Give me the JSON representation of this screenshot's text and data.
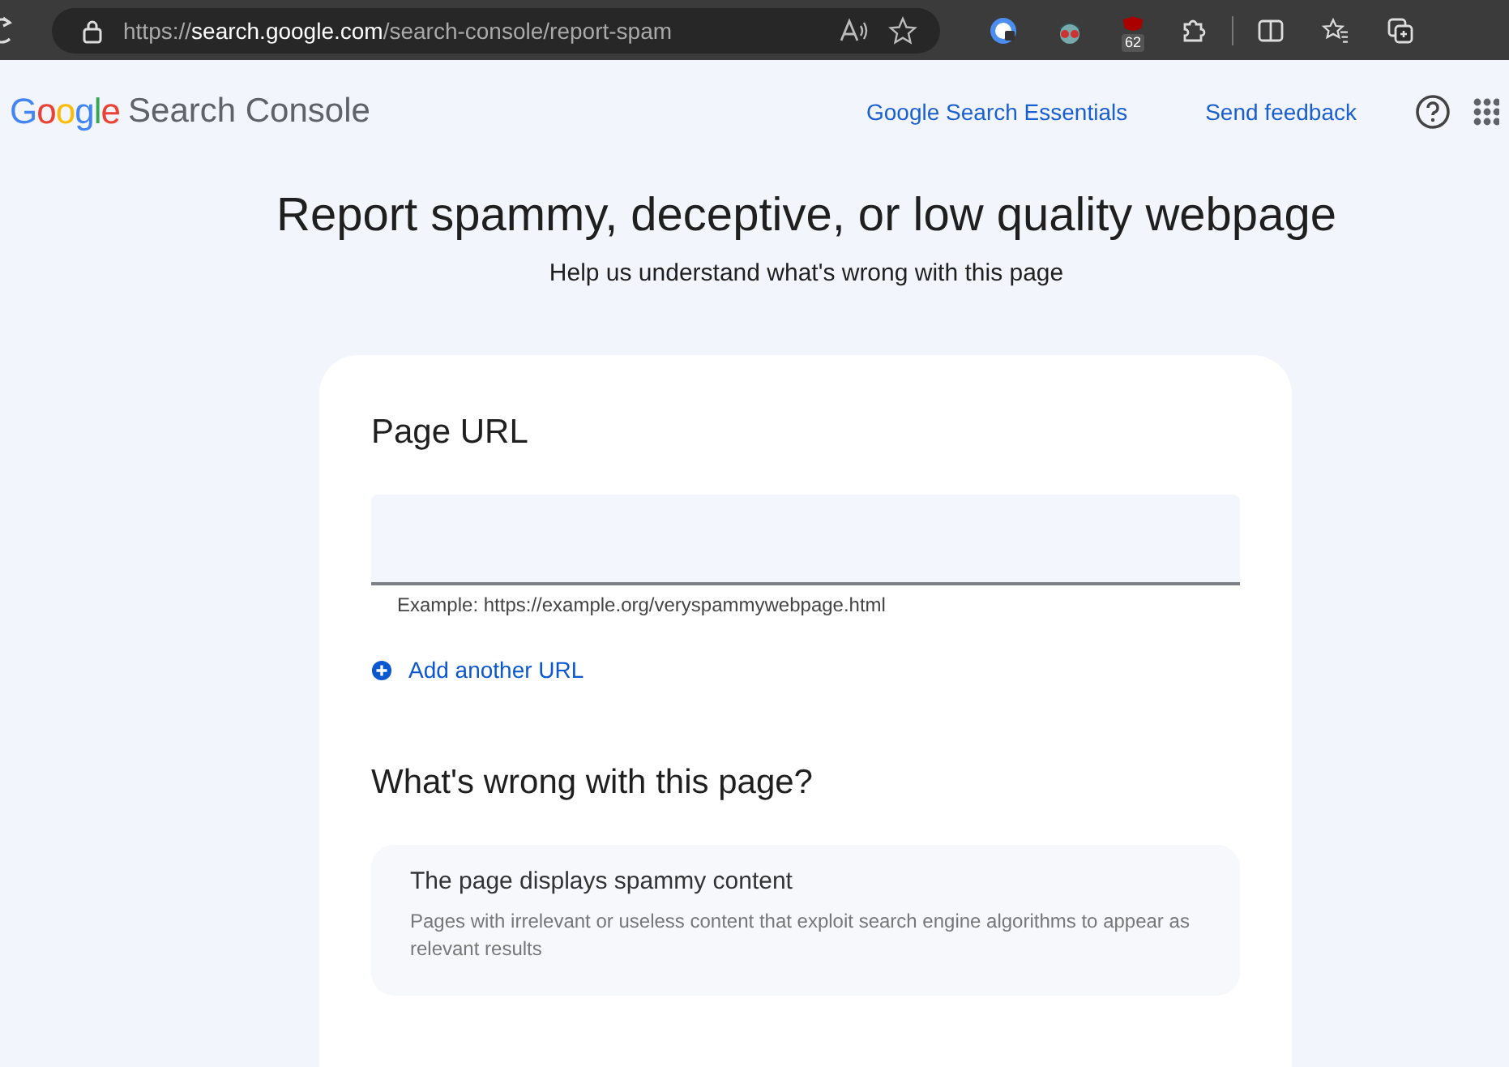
{
  "browser": {
    "url_host": "https://search.google.com",
    "url_path": "/search-console/report-spam",
    "extension_badge": "62"
  },
  "header": {
    "logo": "Google",
    "product": "Search Console",
    "links": [
      "Google Search Essentials",
      "Send feedback"
    ]
  },
  "title": "Report spammy, deceptive, or low quality webpage",
  "subtitle": "Help us understand what's wrong with this page",
  "form": {
    "url_label": "Page URL",
    "hint": "Example: https://example.org/veryspammywebpage.html",
    "add_url": "Add another URL",
    "question": "What's wrong with this page?",
    "options": [
      {
        "title": "The page displays spammy content",
        "description": "Pages with irrelevant or useless content that exploit search engine algorithms to appear as relevant results"
      }
    ]
  }
}
